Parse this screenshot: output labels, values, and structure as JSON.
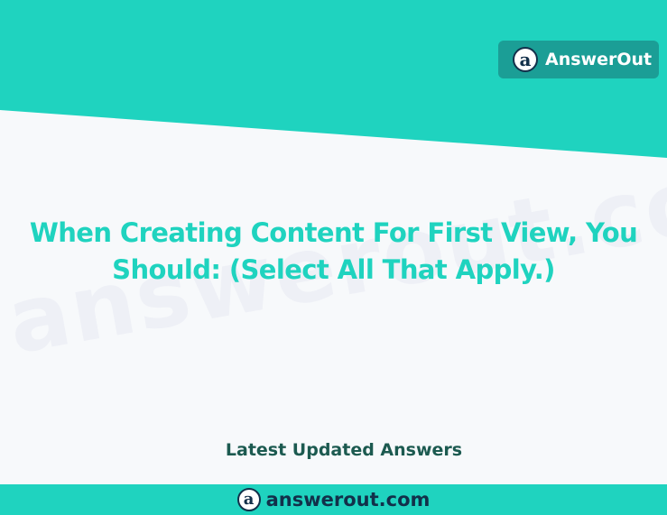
{
  "brand": {
    "name": "AnswerOut",
    "logo_glyph": "a"
  },
  "watermark": "answerout.com",
  "question": {
    "line1": "When Creating Content For First View, You",
    "line2": "Should: (Select All That Apply.)"
  },
  "latest_label": "Latest Updated Answers",
  "footer": {
    "site": "answerout.com",
    "logo_glyph": "a"
  },
  "colors": {
    "teal": "#1fd3bf",
    "badge": "#1b9e96",
    "navy": "#12304a",
    "dark_green": "#1c5a50",
    "background": "#f7f9fb"
  }
}
